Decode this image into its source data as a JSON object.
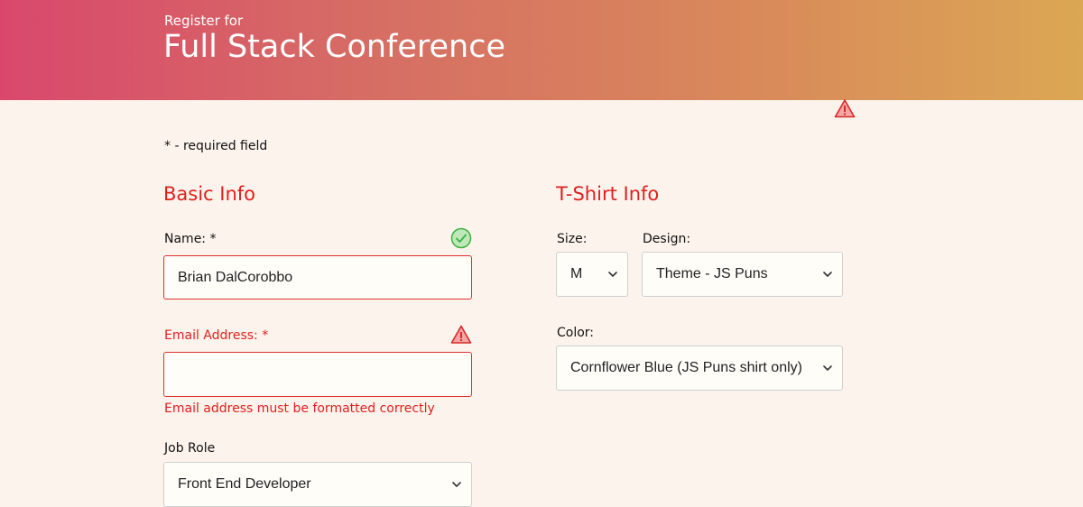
{
  "header": {
    "pre_title": "Register for",
    "title": "Full Stack Conference"
  },
  "required_note": "* - required field",
  "basic_info": {
    "heading": "Basic Info",
    "name": {
      "label": "Name: *",
      "value": "Brian DalCorobbo",
      "status_icon": "check-circle-icon"
    },
    "email": {
      "label": "Email Address: *",
      "value": "",
      "status_icon": "warning-icon",
      "error": "Email address must be formatted correctly"
    },
    "job_role": {
      "label": "Job Role",
      "selected": "Front End Developer"
    }
  },
  "tshirt_info": {
    "heading": "T-Shirt Info",
    "size": {
      "label": "Size:",
      "selected": "M"
    },
    "design": {
      "label": "Design:",
      "selected": "Theme - JS Puns"
    },
    "color": {
      "label": "Color:",
      "selected": "Cornflower Blue (JS Puns shirt only)"
    }
  },
  "colors": {
    "accent": "#e02020",
    "valid": "#3cb043",
    "valid_bg": "#bfe8b8",
    "warn_bg": "#f6a5a5",
    "background": "#fcf4ec"
  }
}
